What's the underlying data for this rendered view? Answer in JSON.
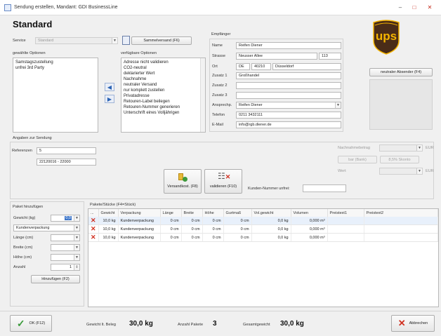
{
  "window": {
    "title": "Sendung erstellen, Mandant: GDI BusinessLine",
    "minimize": "‒",
    "maximize": "□",
    "close": "✕"
  },
  "header": {
    "title": "Standard"
  },
  "service": {
    "label": "Service",
    "value": "Standard"
  },
  "sammelversand": {
    "label": "Sammelversand (F6)"
  },
  "selected_options": {
    "label": "gewählte Optionen",
    "items": [
      "Samstagszustellung",
      "unfrei 3rd Party"
    ]
  },
  "available_options": {
    "label": "verfügbare Optionen",
    "items": [
      "Adresse nicht validieren",
      "CO2-neutral",
      "deklarierter Wert",
      "Nachnahme",
      "neutraler Versand",
      "nur komplett zustellen",
      "Privatadresse",
      "Retouren-Label beilegen",
      "Retouren-Nummer generieren",
      "Unterschrift eines Volljährigen"
    ]
  },
  "recipient": {
    "section_label": "Empfänger",
    "name": {
      "label": "Name",
      "value": "Reifen Diener"
    },
    "strasse": {
      "label": "Strasse",
      "value": "Neusser Allee",
      "nr": "113"
    },
    "ort": {
      "label": "Ort",
      "country": "DE",
      "plz": "40210",
      "city": "Düsseldorf"
    },
    "zusatz1": {
      "label": "Zusatz 1",
      "value": "Großhandel"
    },
    "zusatz2": {
      "label": "Zusatz 2",
      "value": ""
    },
    "zusatz3": {
      "label": "Zusatz 3",
      "value": ""
    },
    "ansprech": {
      "label": "Ansprechp.",
      "value": "Reifen Diener"
    },
    "telefon": {
      "label": "Telefon",
      "value": "0211 3432111"
    },
    "email": {
      "label": "E-Mail",
      "value": "info@rgb.diener.de"
    }
  },
  "logo": {
    "text": "ups"
  },
  "neutral_sender": {
    "label": "neutraler Absender (F4)"
  },
  "shipment": {
    "section_label": "Angaben zur Sendung",
    "ref_label": "Referenzen",
    "ref1": "5",
    "ref2": "22120016 - 22000"
  },
  "nachnahme": {
    "label": "Nachnahmebetrag",
    "currency": "EUR",
    "bar_label": "bar (Bank)",
    "scheck_label": "8,5% Skonto",
    "wert_label": "Wert",
    "wert_currency": "EUR"
  },
  "actions": {
    "versandkost_label": "Versandkost. (F8)",
    "validieren_label": "validieren (F10)",
    "kundennummer_label": "Kunden-Nummer unfrei:",
    "kundennummer_value": ""
  },
  "paket_add": {
    "section_label": "Paket hinzufügen",
    "gewicht_label": "Gewicht (kg)",
    "gewicht_value": "0,0",
    "verpackung_value": "Kundenverpackung",
    "laenge_label": "Länge (cm)",
    "breite_label": "Breite (cm)",
    "hoehe_label": "Höhe (cm)",
    "anzahl_label": "Anzahl",
    "anzahl_value": "1",
    "add_button": "Hinzufügen (F2)"
  },
  "packages": {
    "section_label": "Pakete/Stücke (F4=Stück)",
    "columns": [
      "...",
      "Gewicht",
      "Verpackung",
      "Länge",
      "Breite",
      "Höhe",
      "Gurtmaß",
      "Vol.gewicht",
      "Volumen",
      "Preistext1",
      "Preistext2"
    ],
    "rows": [
      {
        "gewicht": "10,0 kg",
        "verpackung": "Kundenverpackung",
        "laenge": "0 cm",
        "breite": "0 cm",
        "hoehe": "0 cm",
        "gurtmass": "0 cm",
        "volgewicht": "0,0 kg",
        "volumen": "0,000 m³",
        "preis1": "",
        "preis2": ""
      },
      {
        "gewicht": "10,0 kg",
        "verpackung": "Kundenverpackung",
        "laenge": "0 cm",
        "breite": "0 cm",
        "hoehe": "0 cm",
        "gurtmass": "0 cm",
        "volgewicht": "0,0 kg",
        "volumen": "0,000 m³",
        "preis1": "",
        "preis2": ""
      },
      {
        "gewicht": "10,0 kg",
        "verpackung": "Kundenverpackung",
        "laenge": "0 cm",
        "breite": "0 cm",
        "hoehe": "0 cm",
        "gurtmass": "0 cm",
        "volgewicht": "0,0 kg",
        "volumen": "0,000 m³",
        "preis1": "",
        "preis2": ""
      }
    ]
  },
  "footer": {
    "ok_label": "OK (F12)",
    "gewicht_beleg_label": "Gewicht lt. Beleg",
    "gewicht_beleg_value": "30,0 kg",
    "anzahl_pakete_label": "Anzahl Pakete",
    "anzahl_pakete_value": "3",
    "gesamtgewicht_label": "Gesamtgewicht",
    "gesamtgewicht_value": "30,0 kg",
    "cancel_label": "Abbrechen"
  }
}
